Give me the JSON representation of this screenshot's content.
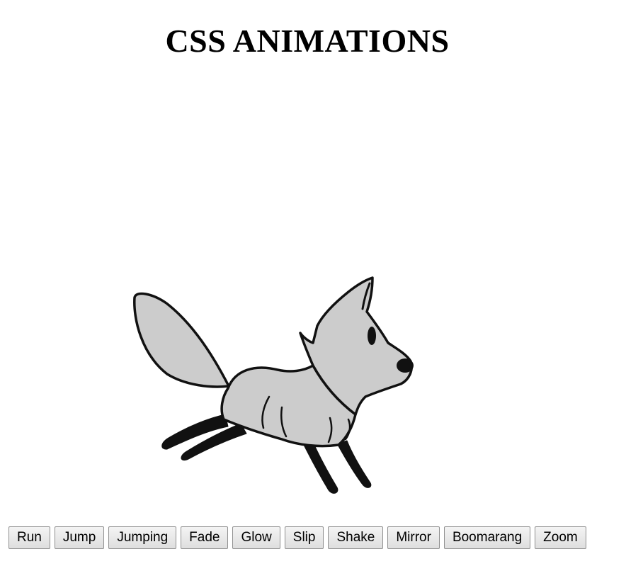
{
  "page": {
    "title": "CSS ANIMATIONS"
  },
  "stage": {
    "image": "fox-illustration",
    "fox_color": "#cccccc",
    "outline_color": "#111111"
  },
  "controls": {
    "buttons": [
      {
        "label": "Run"
      },
      {
        "label": "Jump"
      },
      {
        "label": "Jumping"
      },
      {
        "label": "Fade"
      },
      {
        "label": "Glow"
      },
      {
        "label": "Slip"
      },
      {
        "label": "Shake"
      },
      {
        "label": "Mirror"
      },
      {
        "label": "Boomarang"
      },
      {
        "label": "Zoom"
      }
    ]
  }
}
